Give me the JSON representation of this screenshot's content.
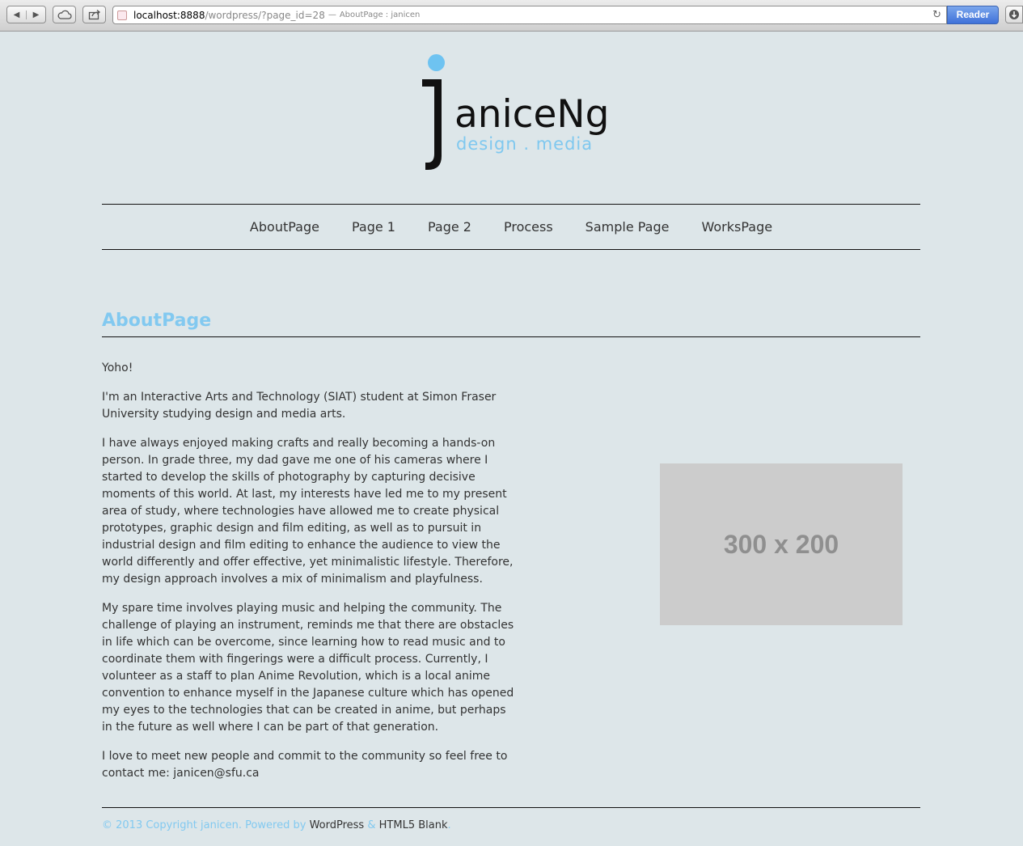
{
  "browser": {
    "url_host": "localhost:8888",
    "url_path": "/wordpress/?page_id=28",
    "url_separator": "—",
    "page_title": "AboutPage : janicen",
    "reader_label": "Reader",
    "reload_icon": "↻",
    "back_icon": "◀",
    "forward_icon": "▶"
  },
  "logo": {
    "name": "aniceNg",
    "tagline": "design . media",
    "colors": {
      "dot": "#6ec3f1",
      "letter": "#111111",
      "tagline": "#7fc8ef"
    }
  },
  "nav": {
    "items": [
      {
        "label": "AboutPage"
      },
      {
        "label": "Page 1"
      },
      {
        "label": "Page 2"
      },
      {
        "label": "Process"
      },
      {
        "label": "Sample Page"
      },
      {
        "label": "WorksPage"
      }
    ]
  },
  "main": {
    "title": "AboutPage",
    "paragraphs": [
      "Yoho!",
      "I'm an Interactive Arts and Technology (SIAT) student at Simon Fraser University studying design and media arts.",
      "I have always enjoyed making crafts and really becoming a hands-on person. In grade three, my dad gave me one of his cameras where I started to develop the skills of photography by capturing decisive moments of this world. At last, my interests have led me to my present area of study, where technologies have allowed me to create physical prototypes, graphic design and film editing, as well as to pursuit in industrial design and film editing to enhance the audience to view the world differently and offer effective, yet minimalistic lifestyle. Therefore, my design approach involves a mix of minimalism and playfulness.",
      "My spare time involves playing music and helping the community. The challenge of playing an instrument, reminds me that there are obstacles in life which can be overcome, since learning how to read music and to coordinate them with fingerings were a difficult process. Currently, I volunteer as a staff to plan Anime Revolution, which is a local anime convention to enhance myself in the Japanese culture which has opened my eyes to the technologies that can be created in anime, but perhaps in the future as well where I can be part of that generation.",
      "I love to meet new people and commit to the community so feel free to contact me: janicen@sfu.ca"
    ],
    "image_placeholder": "300 x 200"
  },
  "footer": {
    "prefix": "© 2013 Copyright janicen. Powered by",
    "link1": "WordPress",
    "amp": "&",
    "link2": "HTML5 Blank",
    "suffix": "."
  },
  "colors": {
    "background": "#dde6e9",
    "accent": "#82c9f0",
    "text": "#333333"
  }
}
